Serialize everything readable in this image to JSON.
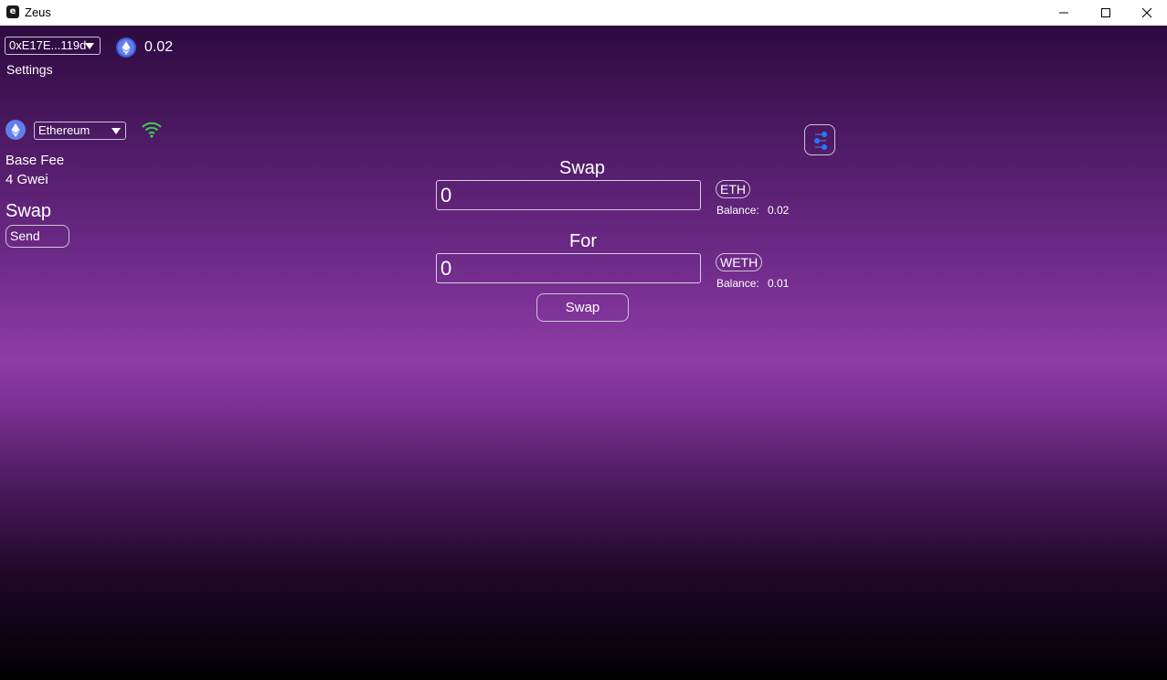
{
  "window": {
    "title": "Zeus"
  },
  "account": {
    "address": "0xE17E...119d",
    "balance": "0.02"
  },
  "nav": {
    "settings": "Settings",
    "swap_heading": "Swap",
    "send": "Send"
  },
  "network": {
    "selected": "Ethereum",
    "base_fee_label": "Base Fee",
    "base_fee_value": "4 Gwei"
  },
  "swap": {
    "from_title": "Swap",
    "from_amount": "0",
    "from_token": "ETH",
    "from_balance_label": "Balance:",
    "from_balance": "0.02",
    "to_title": "For",
    "to_amount": "0",
    "to_token": "WETH",
    "to_balance_label": "Balance:",
    "to_balance": "0.01",
    "submit_label": "Swap"
  },
  "icons": {
    "app": "app-icon",
    "eth": "ethereum-icon",
    "wifi": "wifi-icon",
    "settings": "sliders-icon",
    "caret": "chevron-down-icon"
  },
  "colors": {
    "eth_blue": "#627eea",
    "wifi_green": "#3ecf4a",
    "slider_blue": "#1e7bff"
  }
}
